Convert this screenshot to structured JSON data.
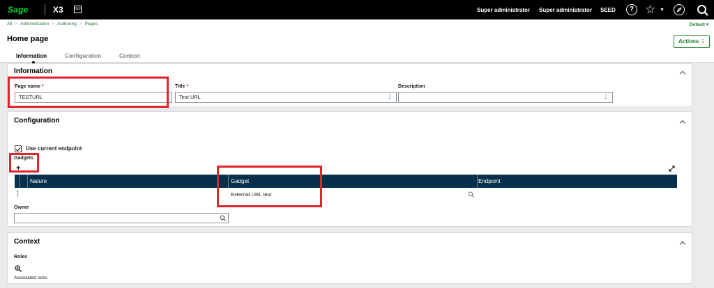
{
  "topbar": {
    "logo": "Sage",
    "app": "X3",
    "user1": "Super administrator",
    "user2": "Super administrator",
    "folder": "SEED",
    "help_glyph": "?"
  },
  "breadcrumb": {
    "items": [
      "All",
      "Administration",
      "Authoring",
      "Pages"
    ],
    "separator": ">",
    "default_label": "Default ▾"
  },
  "header": {
    "title": "Home page",
    "actions_label": "Actions",
    "tabs": [
      {
        "label": "Information"
      },
      {
        "label": "Configuration"
      },
      {
        "label": "Context"
      }
    ]
  },
  "information": {
    "title": "Information",
    "page_name_label": "Page name",
    "page_name_value": "TESTURL",
    "title_label": "Title",
    "title_value": "Test URL",
    "description_label": "Description",
    "description_value": "",
    "required_mark": "*"
  },
  "configuration": {
    "title": "Configuration",
    "use_current_endpoint_label": "Use current endpoint",
    "use_current_endpoint_checked": true,
    "gadgets_label": "Gadgets",
    "add_glyph": "+",
    "columns": [
      "Nature",
      "Gadget",
      "Endpoint"
    ],
    "rows": [
      {
        "nature": "",
        "gadget": "External URL test",
        "endpoint": ""
      }
    ],
    "owner_label": "Owner",
    "owner_value": ""
  },
  "context": {
    "title": "Context",
    "roles_label": "Roles",
    "associated_roles_label": "Associated roles"
  },
  "colors": {
    "brand_green": "#00d639",
    "link_green": "#1e7a2d",
    "grid_header": "#08304d",
    "highlight_red": "#e3232b",
    "required_red": "#d21b1b"
  }
}
